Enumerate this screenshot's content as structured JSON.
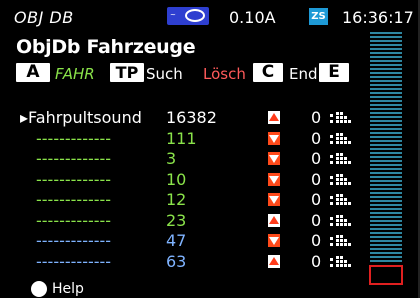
{
  "status": {
    "screen_name": "OBJ DB",
    "current": "0.10A",
    "zs": "ZS",
    "time": "16:36:17",
    "brand_color": "#2e3fd0",
    "zs_color": "#1e9ad6"
  },
  "header": {
    "title": "ObjDb Fahrzeuge",
    "key_a": "A",
    "fahr": "FAHR",
    "key_tp": "TP",
    "such": "Such",
    "losch": "Lösch",
    "key_c": "C",
    "end": "End",
    "key_e": "E"
  },
  "rows": [
    {
      "selected": true,
      "name": "▸Fahrpultsound",
      "address": "16382",
      "direction": "up",
      "speed": "0",
      "name_color": "#ffffff",
      "addr_color": "#ffffff"
    },
    {
      "selected": false,
      "name": "-------------",
      "address": "111",
      "direction": "down",
      "speed": "0",
      "name_color": "#8ae34a",
      "addr_color": "#8ae34a"
    },
    {
      "selected": false,
      "name": "-------------",
      "address": "3",
      "direction": "down",
      "speed": "0",
      "name_color": "#8ae34a",
      "addr_color": "#8ae34a"
    },
    {
      "selected": false,
      "name": "-------------",
      "address": "10",
      "direction": "down",
      "speed": "0",
      "name_color": "#8ae34a",
      "addr_color": "#8ae34a"
    },
    {
      "selected": false,
      "name": "-------------",
      "address": "12",
      "direction": "down",
      "speed": "0",
      "name_color": "#8ae34a",
      "addr_color": "#8ae34a"
    },
    {
      "selected": false,
      "name": "-------------",
      "address": "23",
      "direction": "up",
      "speed": "0",
      "name_color": "#8ae34a",
      "addr_color": "#8ae34a"
    },
    {
      "selected": false,
      "name": "-------------",
      "address": "47",
      "direction": "down",
      "speed": "0",
      "name_color": "#7fb3ff",
      "addr_color": "#7fb3ff"
    },
    {
      "selected": false,
      "name": "-------------",
      "address": "63",
      "direction": "up",
      "speed": "0",
      "name_color": "#7fb3ff",
      "addr_color": "#7fb3ff"
    }
  ],
  "footer": {
    "help": "Help"
  },
  "colors": {
    "fahr": "#8ae34a",
    "losch": "#ff5a5a",
    "arrow": "#ff3b1b",
    "meter": "#3aa7c9",
    "meter_marker": "#e02020"
  }
}
